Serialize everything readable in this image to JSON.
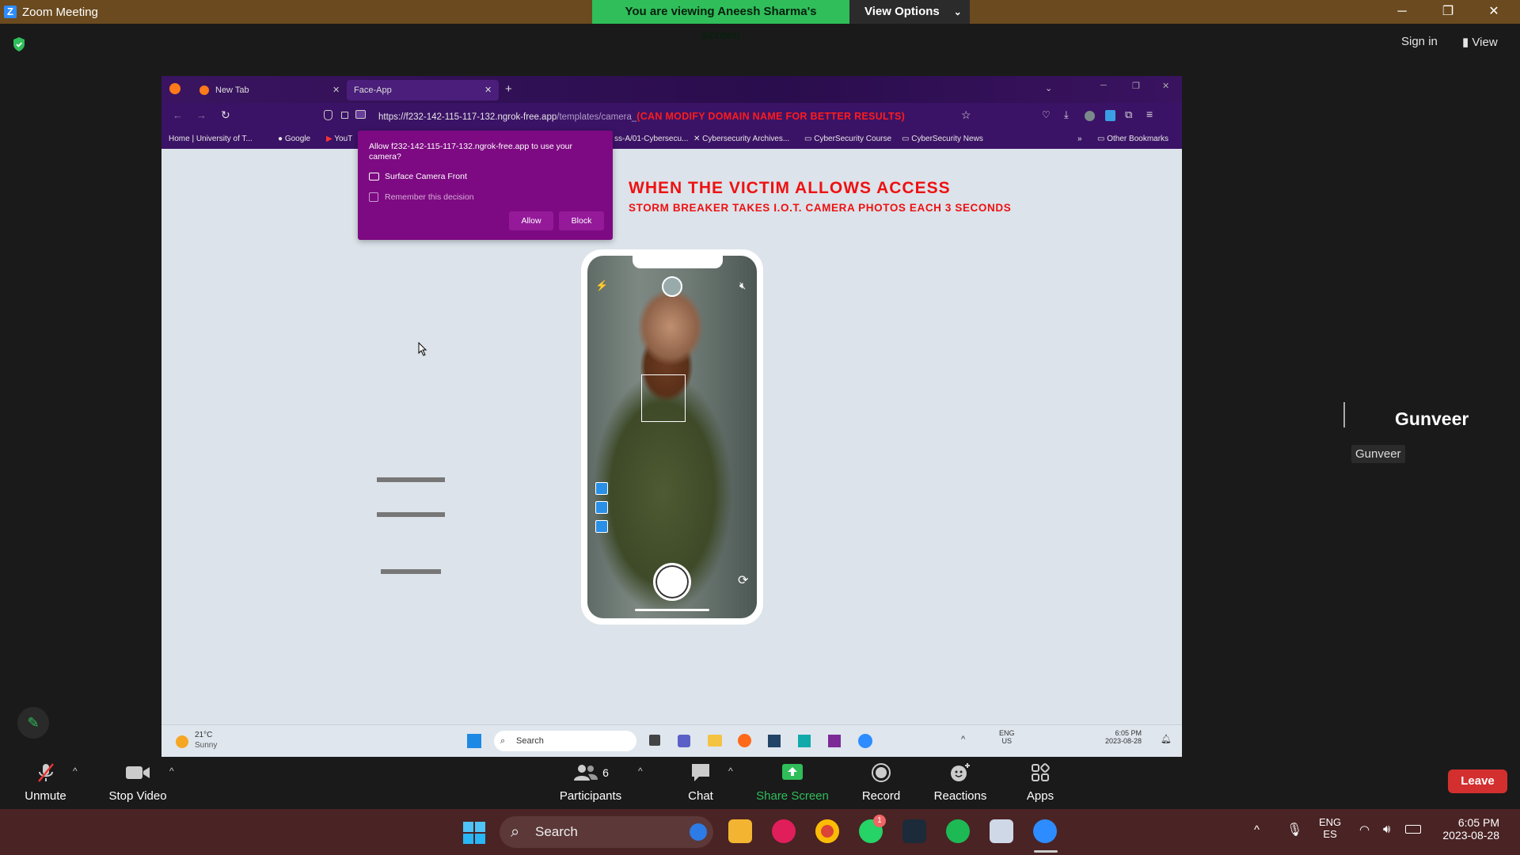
{
  "window": {
    "title": "Zoom Meeting",
    "viewing_banner": "You are viewing Aneesh Sharma's screen",
    "view_options": "View Options"
  },
  "header": {
    "sign_in": "Sign in",
    "view": "View"
  },
  "browser": {
    "tabs": [
      {
        "label": "New Tab"
      },
      {
        "label": "Face-App"
      }
    ],
    "url_host": "https://f232-142-115-117-132.ngrok-free.app",
    "url_path": "/templates/camera_",
    "url_overlay": "(CAN MODIFY DOMAIN NAME FOR BETTER RESULTS)",
    "bookmarks": [
      "Home | University of T...",
      "Google",
      "YouT",
      "ss-A/01-Cybersecu...",
      "Cybersecurity Archives...",
      "CyberSecurity Course",
      "CyberSecurity News",
      "Other Bookmarks"
    ],
    "permission": {
      "question": "Allow f232-142-115-117-132.ngrok-free.app to use your camera?",
      "camera": "Surface Camera Front",
      "remember": "Remember this decision",
      "allow": "Allow",
      "block": "Block"
    },
    "heading1": "WHEN THE VICTIM ALLOWS ACCESS",
    "heading2": "STORM BREAKER TAKES I.O.T. CAMERA PHOTOS EACH 3 SECONDS",
    "inner_taskbar": {
      "temp": "21°C",
      "weather": "Sunny",
      "search": "Search",
      "lang1": "ENG",
      "lang2": "US",
      "time": "6:05 PM",
      "date": "2023-08-28"
    }
  },
  "participant": {
    "name": "Gunveer",
    "tag": "Gunveer"
  },
  "toolbar": {
    "unmute": "Unmute",
    "stop_video": "Stop Video",
    "participants": "Participants",
    "participants_count": "6",
    "chat": "Chat",
    "share_screen": "Share Screen",
    "record": "Record",
    "reactions": "Reactions",
    "apps": "Apps",
    "leave": "Leave"
  },
  "taskbar": {
    "search": "Search",
    "whatsapp_badge": "1",
    "lang1": "ENG",
    "lang2": "ES",
    "time": "6:05 PM",
    "date": "2023-08-28"
  },
  "colors": {
    "share_green": "#2fbe5a",
    "leave_red": "#d32f2f",
    "titlebar": "#6b4a1f",
    "warning_red": "#e11111"
  }
}
